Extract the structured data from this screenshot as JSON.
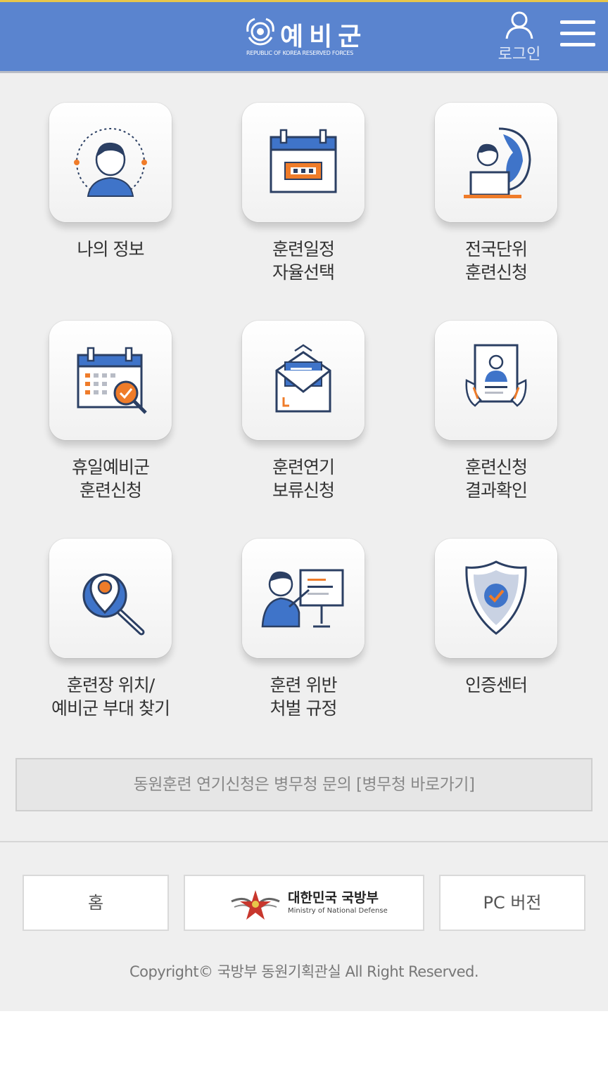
{
  "header": {
    "brand_title": "예비군",
    "brand_subtitle": "REPUBLIC OF KOREA RESERVED FORCES",
    "login_label": "로그인",
    "menu_icon": "hamburger-icon",
    "login_icon": "user-icon",
    "colors": {
      "bar": "#5a84cf",
      "accent_line": "#e8c64a"
    }
  },
  "menu": [
    {
      "label": "나의 정보",
      "icon": "user-profile-icon"
    },
    {
      "label": "훈련일정\n자율선택",
      "icon": "calendar-icon"
    },
    {
      "label": "전국단위\n훈련신청",
      "icon": "laptop-globe-icon"
    },
    {
      "label": "휴일예비군\n훈련신청",
      "icon": "calendar-search-icon"
    },
    {
      "label": "훈련연기\n보류신청",
      "icon": "envelope-icon"
    },
    {
      "label": "훈련신청\n결과확인",
      "icon": "id-document-icon"
    },
    {
      "label": "훈련장 위치/\n예비군 부대 찾기",
      "icon": "map-pin-search-icon"
    },
    {
      "label": "훈련 위반\n처벌 규정",
      "icon": "presenter-board-icon"
    },
    {
      "label": "인증센터",
      "icon": "shield-check-icon"
    }
  ],
  "notice": {
    "text": "동원훈련 연기신청은 병무청 문의 [병무청 바로가기]"
  },
  "footer": {
    "home_label": "홈",
    "mnd_title": "대한민국 국방부",
    "mnd_subtitle": "Ministry of National Defense",
    "pc_label": "PC 버전",
    "copyright": "Copyright© 국방부 동원기획관실 All Right Reserved."
  }
}
